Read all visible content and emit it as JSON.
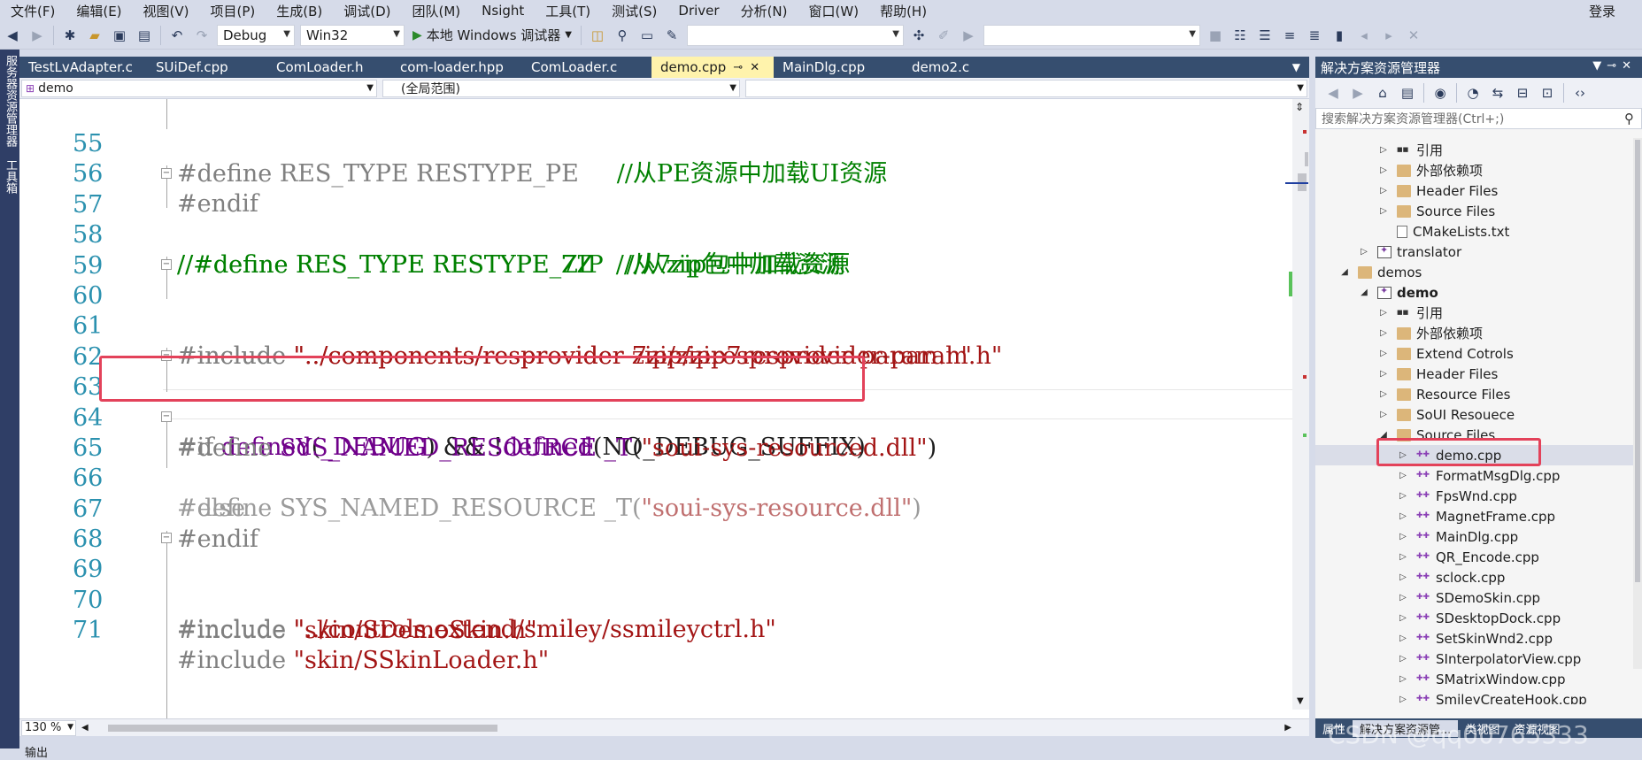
{
  "menu": [
    "文件(F)",
    "编辑(E)",
    "视图(V)",
    "项目(P)",
    "生成(B)",
    "调试(D)",
    "团队(M)",
    "Nsight",
    "工具(T)",
    "测试(S)",
    "Driver",
    "分析(N)",
    "窗口(W)",
    "帮助(H)"
  ],
  "login": "登录",
  "toolbar": {
    "config": "Debug",
    "platform": "Win32",
    "run_label": "本地 Windows 调试器"
  },
  "leftstrip": [
    "服务器资源管理器",
    "工具箱"
  ],
  "tabs": [
    {
      "label": "TestLvAdapter.c",
      "active": false
    },
    {
      "label": "SUiDef.cpp",
      "active": false
    },
    {
      "label": "ComLoader.h",
      "active": false
    },
    {
      "label": "com-loader.hpp",
      "active": false
    },
    {
      "label": "ComLoader.c",
      "active": false
    },
    {
      "label": "demo.cpp",
      "active": true
    },
    {
      "label": "MainDlg.cpp",
      "active": false
    },
    {
      "label": "demo2.c",
      "active": false
    }
  ],
  "nav": {
    "project": "demo",
    "scope": "(全局范围)"
  },
  "code_lines": [
    {
      "n": "55",
      "text": "#define RES_TYPE RESTYPE_PE     //从PE资源中加载UI资源"
    },
    {
      "n": "56",
      "text": "#endif"
    },
    {
      "n": "57",
      "text": "//#define RES_TYPE RESTYPE_ZIP   //从zip包中加载资源"
    },
    {
      "n": "58",
      "text": "//#define RES_TYPE RESTYPE_7Z   //从7zip包中加载资源"
    },
    {
      "n": "59",
      "text": ""
    },
    {
      "n": "60",
      "text": "#include \"../components/resprovider-7zip/zip7resprovider-param.h\""
    },
    {
      "n": "61",
      "text": "#include \"../components/resprovider-zip/zipresprovider-param.h\""
    },
    {
      "n": "62",
      "text": ""
    },
    {
      "n": "63",
      "text": "#if defined(_DEBUG) && !defined(NO_DEBUG_SUFFIX)"
    },
    {
      "n": "64",
      "text": "#define SYS_NAMED_RESOURCE _T(\"soui-sys-resourced.dll\")"
    },
    {
      "n": "65",
      "text": "#else"
    },
    {
      "n": "66",
      "text": "#define SYS_NAMED_RESOURCE _T(\"soui-sys-resource.dll\")"
    },
    {
      "n": "67",
      "text": "#endif"
    },
    {
      "n": "68",
      "text": ""
    },
    {
      "n": "69",
      "text": "#include \"../controls.extend/smiley/ssmileyctrl.h\""
    },
    {
      "n": "70",
      "text": "#include \"skin/SDemoSkin.h\""
    },
    {
      "n": "71",
      "text": "#include \"skin/SSkinLoader.h\""
    }
  ],
  "code_parts": {
    "l55_pp": "#define RES_TYPE RESTYPE_PE     ",
    "l55_cm": "//从PE资源中加载UI资源",
    "l56": "#endif",
    "l57": "//#define RES_TYPE RESTYPE_ZIP   //从zip包中加载资源",
    "l58": "//#define RES_TYPE RESTYPE_7Z   //从7zip包中加载资源",
    "l60_pp": "#include ",
    "l60_st": "\"../components/resprovider-7zip/zip7resprovider-param.h\"",
    "l61_pp": "#include ",
    "l61_st": "\"../components/resprovider-zip/zipresprovider-param.h\"",
    "l63_a": "#if ",
    "l63_b": "defined",
    "l63_c": "(",
    "l63_d": "_DEBUG",
    "l63_e": ") && !",
    "l63_f": "defined",
    "l63_g": "(NO_DEBUG_SUFFIX)",
    "l64_pp": "#define ",
    "l64_mac": "SYS_NAMED_RESOURCE _T",
    "l64_p1": "(",
    "l64_st": "\"soui-sys-resourced.dll\"",
    "l64_p2": ")",
    "l65": "#else",
    "l66_pp": "#define SYS_NAMED_RESOURCE _T(",
    "l66_st": "\"soui-sys-resource.dll\"",
    "l66_p2": ")",
    "l67": "#endif",
    "l69_pp": "#include ",
    "l69_st": "\"../controls.extend/smiley/ssmileyctrl.h\"",
    "l70_pp": "#include ",
    "l70_st": "\"skin/SDemoSkin.h\"",
    "l71_pp": "#include ",
    "l71_st": "\"skin/SSkinLoader.h\""
  },
  "zoom": "130 %",
  "output_label": "输出",
  "solution_explorer": {
    "title": "解决方案资源管理器",
    "search_placeholder": "搜索解决方案资源管理器(Ctrl+;)",
    "items": [
      {
        "label": "引用",
        "icon": "ref",
        "depth": 2,
        "exp": "▷"
      },
      {
        "label": "外部依赖项",
        "icon": "folder",
        "depth": 2,
        "exp": "▷"
      },
      {
        "label": "Header Files",
        "icon": "folder",
        "depth": 2,
        "exp": "▷"
      },
      {
        "label": "Source Files",
        "icon": "folder",
        "depth": 2,
        "exp": "▷"
      },
      {
        "label": "CMakeLists.txt",
        "icon": "txt",
        "depth": 2,
        "exp": ""
      },
      {
        "label": "translator",
        "icon": "proj",
        "depth": 1,
        "exp": "▷"
      },
      {
        "label": "demos",
        "icon": "folder",
        "depth": 0,
        "exp": "◢"
      },
      {
        "label": "demo",
        "icon": "proj",
        "depth": 1,
        "exp": "◢",
        "bold": true
      },
      {
        "label": "引用",
        "icon": "ref",
        "depth": 2,
        "exp": "▷"
      },
      {
        "label": "外部依赖项",
        "icon": "folder",
        "depth": 2,
        "exp": "▷"
      },
      {
        "label": "Extend Cotrols",
        "icon": "folder",
        "depth": 2,
        "exp": "▷"
      },
      {
        "label": "Header Files",
        "icon": "folder",
        "depth": 2,
        "exp": "▷"
      },
      {
        "label": "Resource Files",
        "icon": "folder",
        "depth": 2,
        "exp": "▷"
      },
      {
        "label": "SoUI Resouece",
        "icon": "folder",
        "depth": 2,
        "exp": "▷"
      },
      {
        "label": "Source Files",
        "icon": "folder",
        "depth": 2,
        "exp": "◢"
      },
      {
        "label": "demo.cpp",
        "icon": "cpp",
        "depth": 3,
        "exp": "▷",
        "selected": true
      },
      {
        "label": "FormatMsgDlg.cpp",
        "icon": "cpp",
        "depth": 3,
        "exp": "▷"
      },
      {
        "label": "FpsWnd.cpp",
        "icon": "cpp",
        "depth": 3,
        "exp": "▷"
      },
      {
        "label": "MagnetFrame.cpp",
        "icon": "cpp",
        "depth": 3,
        "exp": "▷"
      },
      {
        "label": "MainDlg.cpp",
        "icon": "cpp",
        "depth": 3,
        "exp": "▷"
      },
      {
        "label": "QR_Encode.cpp",
        "icon": "cpp",
        "depth": 3,
        "exp": "▷"
      },
      {
        "label": "sclock.cpp",
        "icon": "cpp",
        "depth": 3,
        "exp": "▷"
      },
      {
        "label": "SDemoSkin.cpp",
        "icon": "cpp",
        "depth": 3,
        "exp": "▷"
      },
      {
        "label": "SDesktopDock.cpp",
        "icon": "cpp",
        "depth": 3,
        "exp": "▷"
      },
      {
        "label": "SetSkinWnd2.cpp",
        "icon": "cpp",
        "depth": 3,
        "exp": "▷"
      },
      {
        "label": "SInterpolatorView.cpp",
        "icon": "cpp",
        "depth": 3,
        "exp": "▷"
      },
      {
        "label": "SMatrixWindow.cpp",
        "icon": "cpp",
        "depth": 3,
        "exp": "▷"
      },
      {
        "label": "SmileyCreateHook.cpp",
        "icon": "cpp",
        "depth": 3,
        "exp": "▷"
      }
    ],
    "bottom_tabs": [
      "属性",
      "解决方案资源管...",
      "类视图",
      "资源视图"
    ]
  },
  "watermark": "CSDN @qq00765333"
}
